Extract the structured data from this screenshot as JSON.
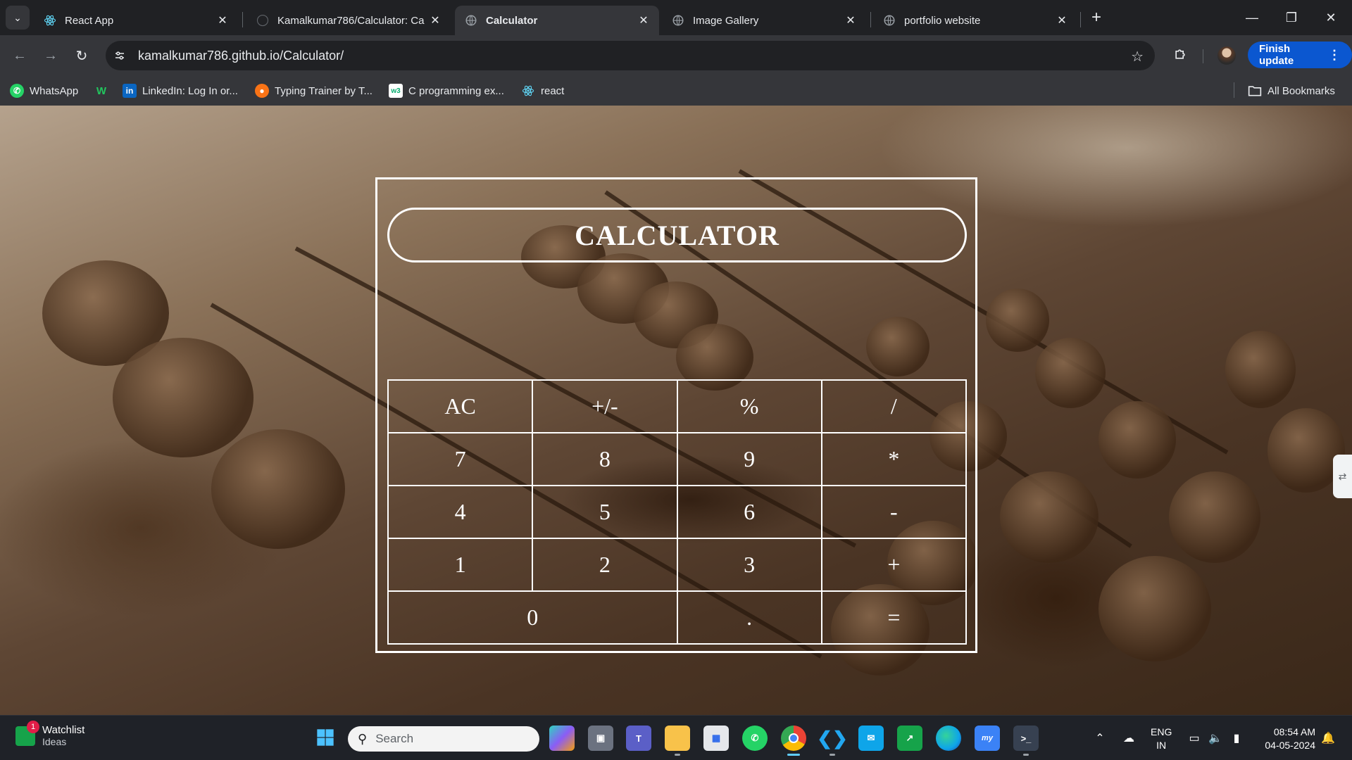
{
  "browser": {
    "tabs": [
      {
        "title": "React App",
        "active": false,
        "icon": "react-icon"
      },
      {
        "title": "Kamalkumar786/Calculator: Ca",
        "active": false,
        "icon": "github-icon"
      },
      {
        "title": "Calculator",
        "active": true,
        "icon": "globe-icon"
      },
      {
        "title": "Image Gallery",
        "active": false,
        "icon": "globe-icon"
      },
      {
        "title": "portfolio website",
        "active": false,
        "icon": "globe-icon"
      }
    ],
    "url": "kamalkumar786.github.io/Calculator/",
    "finish_update_label": "Finish update",
    "bookmarks": [
      {
        "label": "WhatsApp",
        "icon": "whatsapp-icon"
      },
      {
        "label": "",
        "icon": "w-icon"
      },
      {
        "label": "LinkedIn: Log In or...",
        "icon": "linkedin-icon"
      },
      {
        "label": "Typing Trainer by T...",
        "icon": "typing-icon"
      },
      {
        "label": "C programming ex...",
        "icon": "w3-icon"
      },
      {
        "label": "react",
        "icon": "react-icon"
      }
    ],
    "all_bookmarks_label": "All Bookmarks"
  },
  "calculator": {
    "title": "CALCULATOR",
    "display": "",
    "keys": {
      "ac": "AC",
      "sign": "+/-",
      "percent": "%",
      "divide": "/",
      "seven": "7",
      "eight": "8",
      "nine": "9",
      "multiply": "*",
      "four": "4",
      "five": "5",
      "six": "6",
      "minus": "-",
      "one": "1",
      "two": "2",
      "three": "3",
      "plus": "+",
      "zero": "0",
      "dot": ".",
      "equals": "="
    }
  },
  "taskbar": {
    "watchlist_title": "Watchlist",
    "watchlist_subtitle": "Ideas",
    "watchlist_badge": "1",
    "search_placeholder": "Search",
    "language_line1": "ENG",
    "language_line2": "IN",
    "time": "08:54 AM",
    "date": "04-05-2024"
  },
  "colors": {
    "chrome_dark": "#202124",
    "chrome_toolbar": "#35363a",
    "update_button": "#0b57d0",
    "calculator_lines": "#ffffff",
    "taskbar": "#1f2228"
  }
}
